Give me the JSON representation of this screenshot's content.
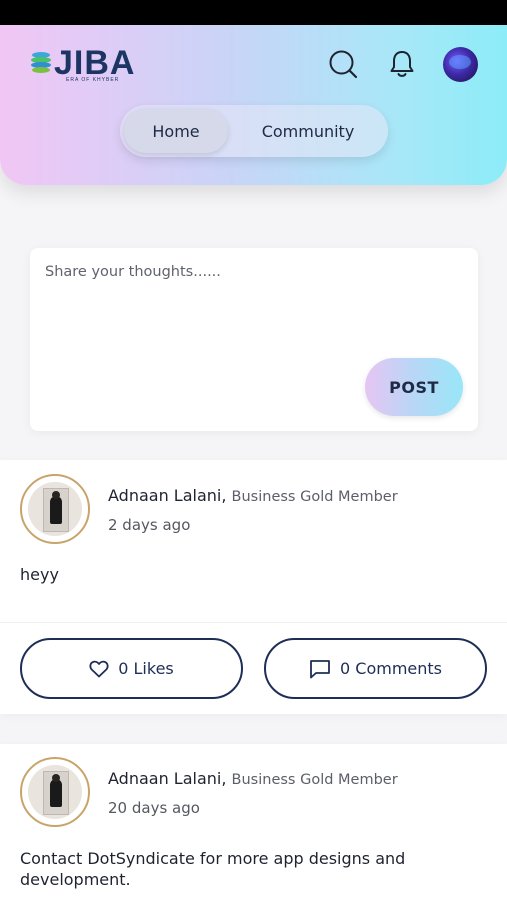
{
  "app": {
    "logo_text": "JIBA",
    "logo_tagline": "ERA OF KHYBER"
  },
  "header": {
    "tabs": [
      {
        "label": "Home",
        "active": true
      },
      {
        "label": "Community",
        "active": false
      }
    ],
    "icons": [
      "search-icon",
      "bell-icon",
      "avatar"
    ]
  },
  "composer": {
    "placeholder": "Share your thoughts......",
    "post_label": "POST"
  },
  "posts": [
    {
      "author": "Adnaan Lalani,",
      "role": "Business Gold Member",
      "time": "2 days ago",
      "text": "heyy",
      "likes_label": "0 Likes",
      "comments_label": "0 Comments"
    },
    {
      "author": "Adnaan Lalani,",
      "role": "Business Gold Member",
      "time": "20 days ago",
      "text": "Contact DotSyndicate for more app designs and development."
    }
  ],
  "colors": {
    "brand_navy": "#1c3563",
    "button_border": "#1f2e57",
    "gradient_start": "#f1c6f5",
    "gradient_end": "#8cecf8"
  }
}
